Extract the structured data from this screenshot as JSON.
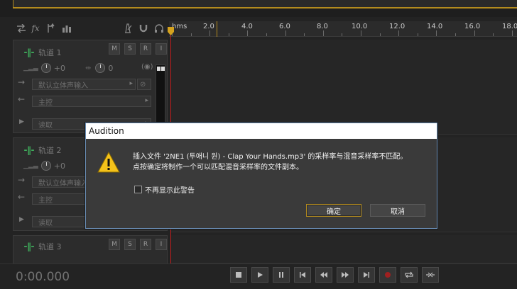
{
  "ruler": {
    "unit": "hms",
    "ticks": [
      "2.0",
      "4.0",
      "6.0",
      "8.0",
      "10.0",
      "12.0",
      "14.0",
      "16.0",
      "18.0"
    ]
  },
  "tracks": [
    {
      "name": "轨道 1",
      "volume": "+0",
      "pan": "0",
      "input": "默认立体声输入",
      "output": "主控",
      "mode": "读取"
    },
    {
      "name": "轨道 2",
      "volume": "+0",
      "pan": "0",
      "input": "默认立体声输入",
      "output": "主控",
      "mode": "读取"
    },
    {
      "name": "轨道 3"
    }
  ],
  "track_buttons": {
    "mute": "M",
    "solo": "S",
    "arm": "R",
    "monitor": "I"
  },
  "transport": {
    "time": "0:00.000"
  },
  "dialog": {
    "title": "Audition",
    "message_line1": "插入文件 '2NE1 (투애니 원) - Clap Your Hands.mp3' 的采样率与混音采样率不匹配。",
    "message_line2": "点按确定将制作一个可以匹配混音采样率的文件副本。",
    "checkbox_label": "不再显示此警告",
    "checkbox_checked": false,
    "ok_label": "确定",
    "cancel_label": "取消"
  },
  "colors": {
    "accent": "#b38b1e",
    "playhead": "#c21e1e",
    "wave": "#3fae5c",
    "dialog_border": "#6b8fb8"
  }
}
